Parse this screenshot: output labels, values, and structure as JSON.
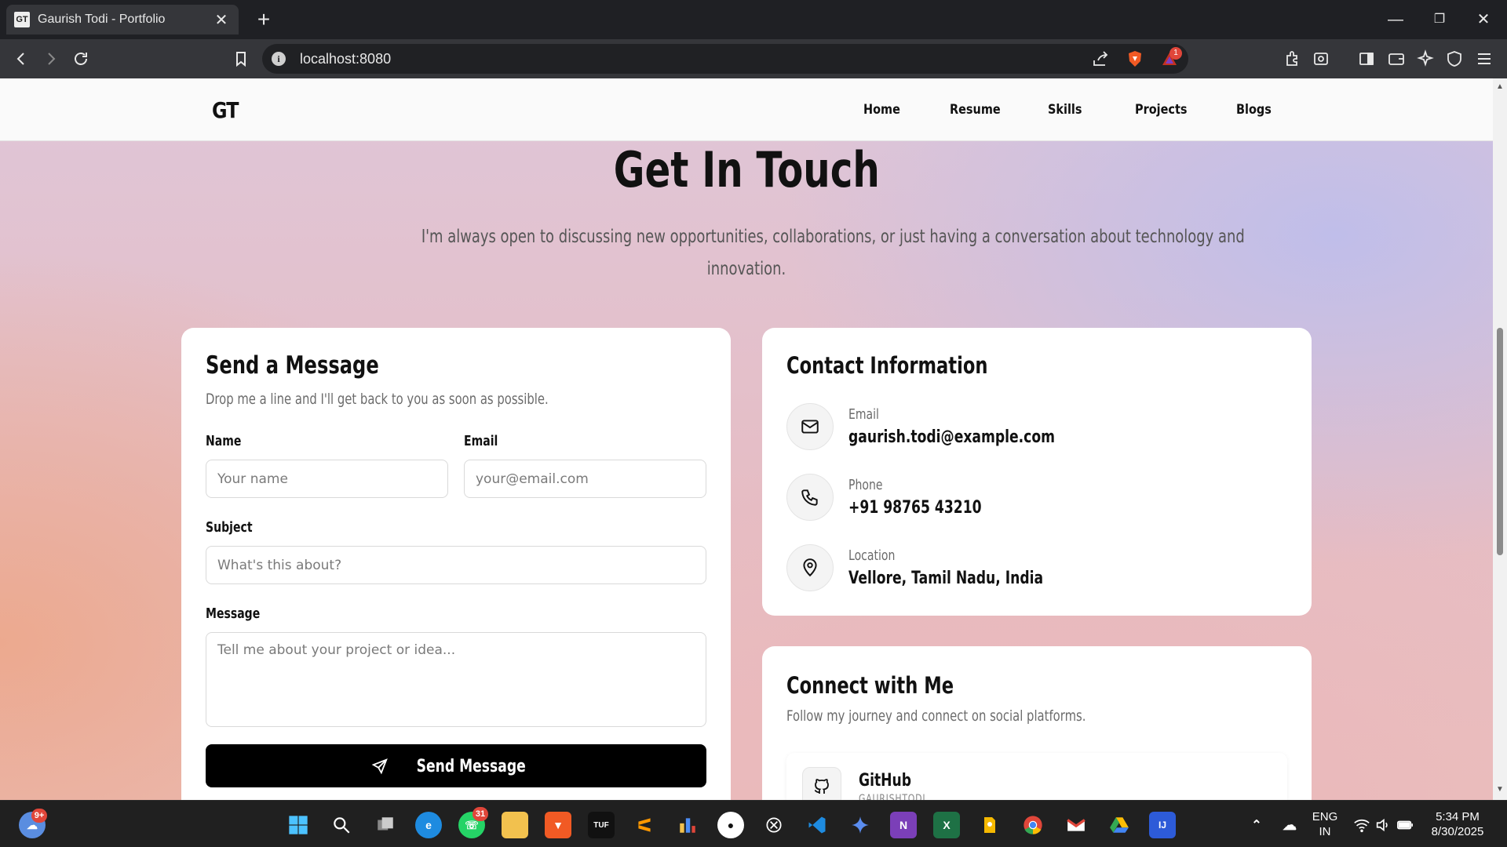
{
  "browser": {
    "tab_title": "Gaurish Todi - Portfolio",
    "tab_favicon_text": "GT",
    "url": "localhost:8080",
    "notification_count": "1"
  },
  "nav": {
    "logo": "GT",
    "links": [
      "Home",
      "Resume",
      "Skills",
      "Projects",
      "Blogs"
    ]
  },
  "hero": {
    "title": "Get In Touch",
    "subtitle_line1": "I'm always open to discussing new opportunities, collaborations, or just having a conversation about technology and",
    "subtitle_line2": "innovation."
  },
  "message_form": {
    "title": "Send a Message",
    "description": "Drop me a line and I'll get back to you as soon as possible.",
    "name_label": "Name",
    "name_placeholder": "Your name",
    "email_label": "Email",
    "email_placeholder": "your@email.com",
    "subject_label": "Subject",
    "subject_placeholder": "What's this about?",
    "message_label": "Message",
    "message_placeholder": "Tell me about your project or idea...",
    "send_label": "Send Message"
  },
  "contact_info": {
    "title": "Contact Information",
    "items": [
      {
        "label": "Email",
        "value": "gaurish.todi@example.com",
        "icon": "mail-icon"
      },
      {
        "label": "Phone",
        "value": "+91 98765 43210",
        "icon": "phone-icon"
      },
      {
        "label": "Location",
        "value": "Vellore, Tamil Nadu, India",
        "icon": "location-pin-icon"
      }
    ]
  },
  "connect": {
    "title": "Connect with Me",
    "description": "Follow my journey and connect on social platforms.",
    "socials": [
      {
        "name": "GitHub",
        "handle": "GAURISHTODI",
        "icon": "github-icon"
      }
    ]
  },
  "taskbar": {
    "weather_badge": "9+",
    "whatsapp_badge": "31",
    "language": "ENG",
    "region": "IN",
    "time": "5:34 PM",
    "date": "8/30/2025"
  },
  "colors": {
    "accent": "#000000",
    "card_bg": "#ffffff",
    "badge_red": "#e0463a"
  }
}
